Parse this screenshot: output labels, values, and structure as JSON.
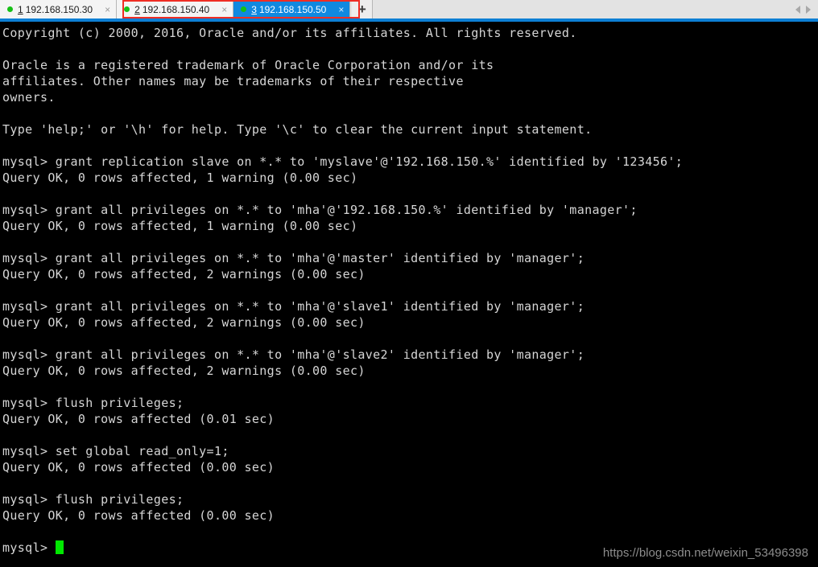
{
  "tabbar": {
    "tabs": [
      {
        "index": "1",
        "label": "192.168.150.30",
        "state": "inactive",
        "status_icon": "green-dot",
        "close_icon": "×"
      },
      {
        "index": "2",
        "label": "192.168.150.40",
        "state": "inactive",
        "status_icon": "green-dot",
        "close_icon": "×"
      },
      {
        "index": "3",
        "label": "192.168.150.50",
        "state": "active",
        "status_icon": "green-dot",
        "close_icon": "×"
      }
    ],
    "new_tab_label": "+",
    "scroll_left_icon": "triangle-left-icon",
    "scroll_right_icon": "triangle-right-icon",
    "selection_highlight_color": "#ef2d24",
    "active_tab_color": "#1089e0",
    "status_dot_color": "#16c016"
  },
  "terminal": {
    "prompt": "mysql> ",
    "cursor_color": "#00e800",
    "text_color": "#d6d6d6",
    "background_color": "#000000",
    "lines": [
      "Copyright (c) 2000, 2016, Oracle and/or its affiliates. All rights reserved.",
      "",
      "Oracle is a registered trademark of Oracle Corporation and/or its",
      "affiliates. Other names may be trademarks of their respective",
      "owners.",
      "",
      "Type 'help;' or '\\h' for help. Type '\\c' to clear the current input statement.",
      "",
      "mysql> grant replication slave on *.* to 'myslave'@'192.168.150.%' identified by '123456';",
      "Query OK, 0 rows affected, 1 warning (0.00 sec)",
      "",
      "mysql> grant all privileges on *.* to 'mha'@'192.168.150.%' identified by 'manager';",
      "Query OK, 0 rows affected, 1 warning (0.00 sec)",
      "",
      "mysql> grant all privileges on *.* to 'mha'@'master' identified by 'manager';",
      "Query OK, 0 rows affected, 2 warnings (0.00 sec)",
      "",
      "mysql> grant all privileges on *.* to 'mha'@'slave1' identified by 'manager';",
      "Query OK, 0 rows affected, 2 warnings (0.00 sec)",
      "",
      "mysql> grant all privileges on *.* to 'mha'@'slave2' identified by 'manager';",
      "Query OK, 0 rows affected, 2 warnings (0.00 sec)",
      "",
      "mysql> flush privileges;",
      "Query OK, 0 rows affected (0.01 sec)",
      "",
      "mysql> set global read_only=1;",
      "Query OK, 0 rows affected (0.00 sec)",
      "",
      "mysql> flush privileges;",
      "Query OK, 0 rows affected (0.00 sec)",
      ""
    ],
    "watermark": "https://blog.csdn.net/weixin_53496398"
  }
}
